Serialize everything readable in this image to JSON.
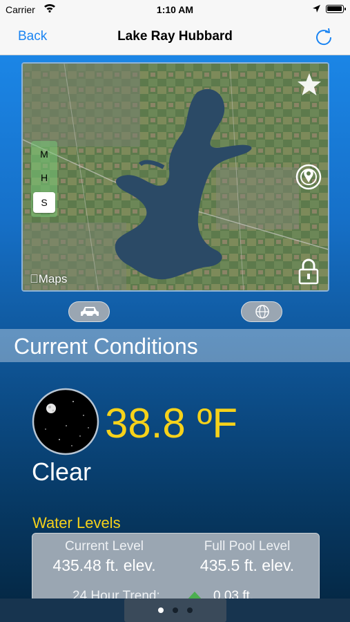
{
  "status_bar": {
    "carrier": "Carrier",
    "time": "1:10 AM"
  },
  "nav": {
    "back_label": "Back",
    "title": "Lake Ray Hubbard"
  },
  "map": {
    "map_types": [
      "M",
      "H",
      "S"
    ],
    "selected_map_type": "S",
    "attribution": "Maps"
  },
  "conditions": {
    "header": "Current Conditions",
    "temperature": "38.8 ºF",
    "condition": "Clear"
  },
  "water_levels": {
    "title": "Water Levels",
    "current_label": "Current Level",
    "current_value": "435.48 ft. elev.",
    "full_pool_label": "Full Pool Level",
    "full_pool_value": "435.5 ft. elev.",
    "trend_label": "24 Hour Trend:",
    "trend_value": "0.03 ft."
  },
  "pager": {
    "pages": 3,
    "current": 1
  },
  "colors": {
    "accent": "#1a84f2",
    "highlight": "#f6d21a",
    "trend_up": "#4caf50"
  }
}
